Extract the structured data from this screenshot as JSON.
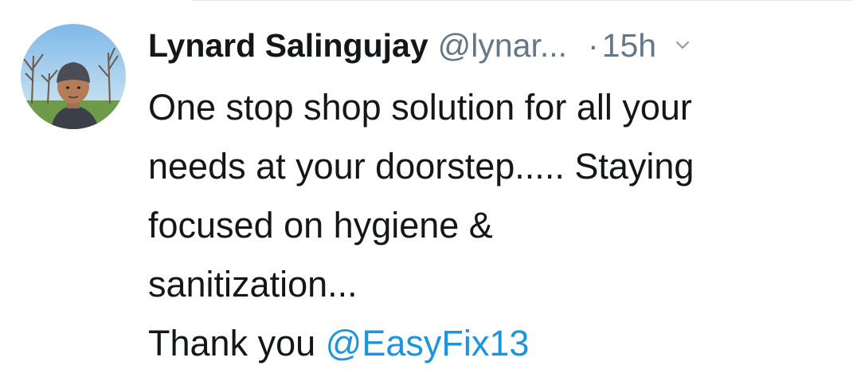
{
  "tweet": {
    "author_name": "Lynard Salingujay",
    "author_handle": "@lynar...",
    "separator": "·",
    "time": "15h",
    "lines": [
      "One stop shop solution for all your",
      "needs at your doorstep..... Staying",
      "focused on hygiene &",
      "sanitization..."
    ],
    "thanks_text": "Thank you ",
    "mention": "@EasyFix13"
  },
  "colors": {
    "text": "#14171a",
    "muted": "#657786",
    "link": "#1b95e0"
  },
  "icons": {
    "caret": "chevron-down-icon"
  }
}
